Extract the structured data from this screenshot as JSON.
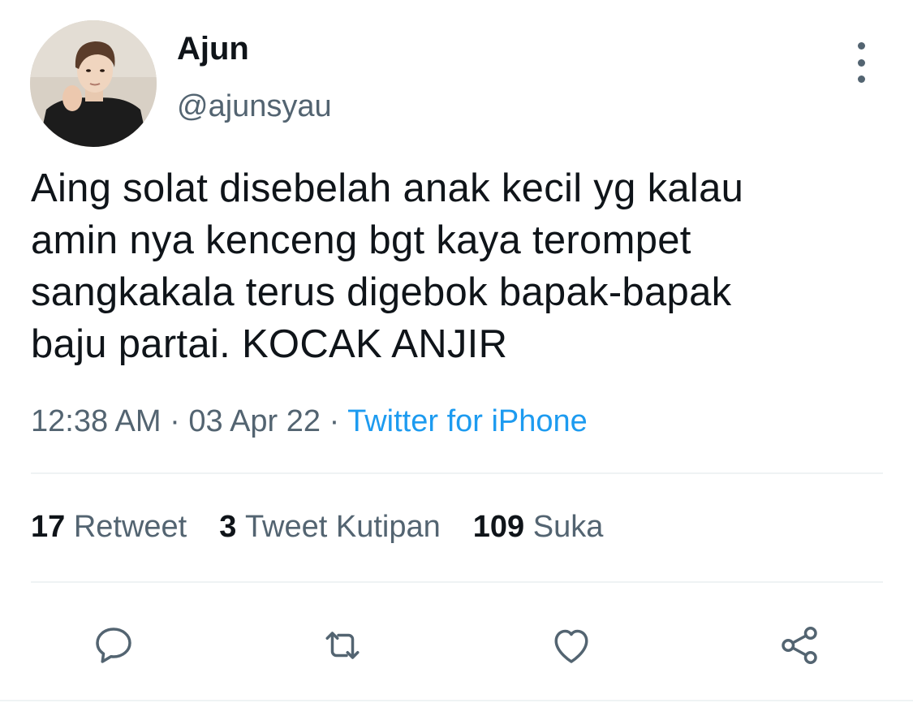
{
  "user": {
    "display_name": "Ajun",
    "handle": "@ajunsyau"
  },
  "tweet": {
    "lines": [
      "Aing solat disebelah anak kecil yg kalau",
      "amin nya kenceng bgt kaya terompet",
      "sangkakala terus digebok bapak-bapak",
      "baju partai. KOCAK ANJIR"
    ],
    "time": "12:38 AM",
    "separator": "·",
    "date": "03 Apr 22",
    "source": "Twitter for iPhone"
  },
  "stats": {
    "retweets": {
      "count": "17",
      "label": "Retweet"
    },
    "quotes": {
      "count": "3",
      "label": "Tweet Kutipan"
    },
    "likes": {
      "count": "109",
      "label": "Suka"
    }
  },
  "actions": [
    "reply-icon",
    "retweet-icon",
    "like-icon",
    "share-icon"
  ],
  "colors": {
    "text": "#0f1419",
    "secondary": "#536471",
    "link": "#1d9bf0",
    "divider": "#eff3f4"
  }
}
